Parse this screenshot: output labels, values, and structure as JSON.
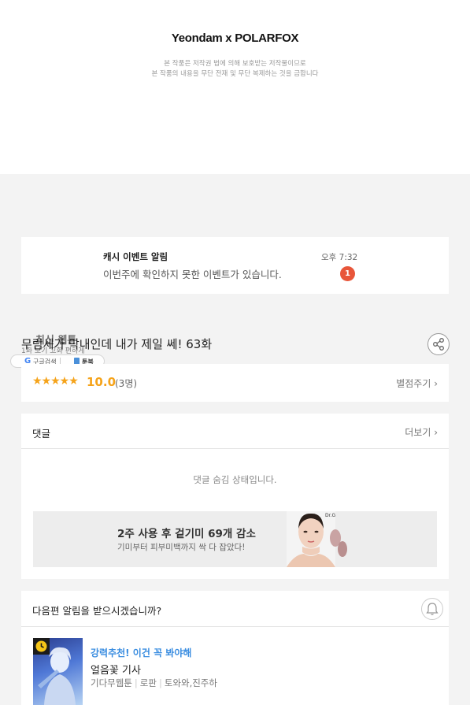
{
  "banner": {
    "brand": "Yeondam x POLARFOX",
    "copyright_line1": "본 작품은 저작권 법에 의해 보호받는 저작물이므로",
    "copyright_line2": "본 작품의 내용을 무단 전재 및 무단 복제하는 것을 금합니다"
  },
  "notice": {
    "title": "캐시 이벤트 알림",
    "message": "이번주에 확인하지 못한 이벤트가 있습니다.",
    "time": "오후 7:32",
    "badge": "1"
  },
  "episode": {
    "title": "무림세가 막내인데 내가 제일 쎄! 63화",
    "overlay_label": "최신 웹툰",
    "overlay_sub": "1화 보기 고화 편하게",
    "search_google": "구글검색",
    "search_toon": "툰북",
    "share_icon": "share-icon"
  },
  "rating": {
    "stars": "★★★★★",
    "score": "10.0",
    "count": "(3명)",
    "give_label": "별점주기 ›"
  },
  "comments": {
    "title": "댓글",
    "more_label": "더보기 ›",
    "hidden_message": "댓글 숨김 상태입니다."
  },
  "ad": {
    "headline": "2주 사용 후 겉기미 69개 감소",
    "subline": "기미부터 피부미백까지 싹 다 잡았다!",
    "brand_tag": "Dr.G"
  },
  "next": {
    "question": "다음편 알림을 받으시겠습니까?",
    "bell_icon": "bell-icon",
    "rec_label": "강력추천! 이건 꼭 봐야해",
    "rec_title": "얼음꽃 기사",
    "rec_genre": "기다무웹툰",
    "rec_type": "로판",
    "rec_authors": "토와와,진주하"
  },
  "colors": {
    "accent_star": "#f5a31a",
    "badge": "#e8563a",
    "link_blue": "#3a8de0"
  }
}
